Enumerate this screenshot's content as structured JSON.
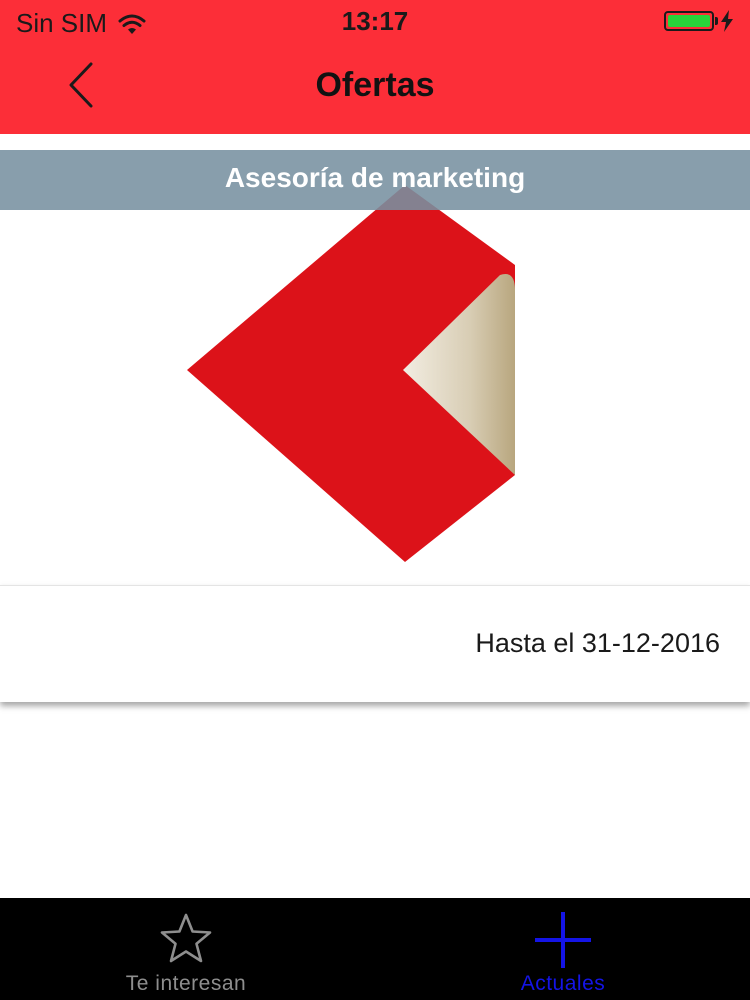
{
  "status_bar": {
    "carrier": "Sin SIM",
    "time": "13:17",
    "battery_level": 1.0,
    "wifi_icon": "wifi-icon",
    "charging_icon": "bolt-icon"
  },
  "nav": {
    "title": "Ofertas",
    "back_icon": "chevron-left-icon"
  },
  "offer": {
    "title": "Asesoría de marketing",
    "until": "Hasta el 31-12-2016",
    "image_icon": "folded-heart-logo"
  },
  "tabs": [
    {
      "label": "Te interesan",
      "icon": "star-icon",
      "selected": false
    },
    {
      "label": "Actuales",
      "icon": "plus-icon",
      "selected": true
    }
  ],
  "colors": {
    "header": "#fc2e38",
    "title_bar": "#7891a0",
    "tab_bar": "#000000",
    "tab_active": "#1414e6",
    "tab_inactive": "#8e8e8e",
    "battery": "#27d43a",
    "logo_red": "#dc1219"
  }
}
